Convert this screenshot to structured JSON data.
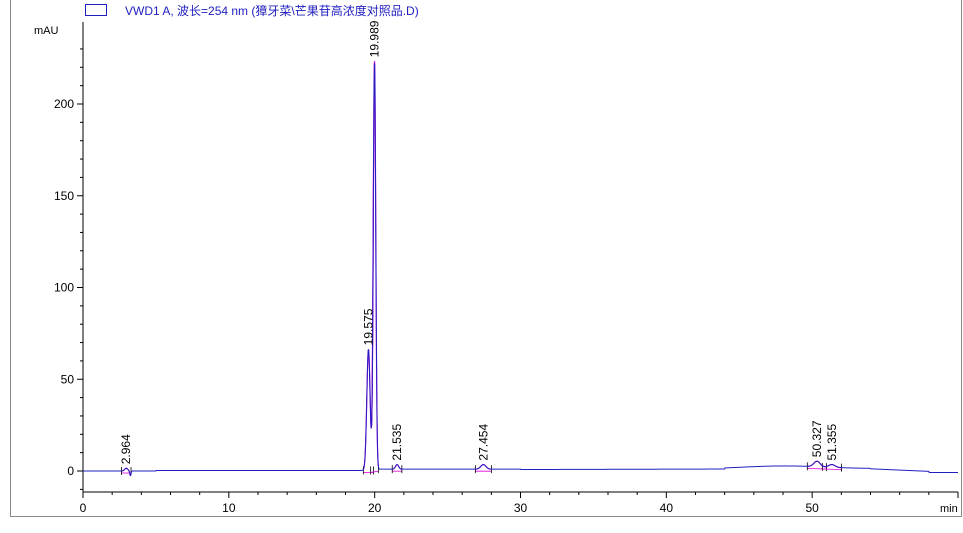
{
  "legend": {
    "label": "VWD1 A, 波长=254 nm (獐牙菜\\芒果苷高浓度对照品.D)",
    "color": "#2020c0"
  },
  "chart_data": {
    "type": "line",
    "xlabel": "min",
    "ylabel": "mAU",
    "xlim": [
      0,
      60
    ],
    "ylim": [
      -12,
      240
    ],
    "x_ticks": [
      0,
      10,
      20,
      30,
      40,
      50
    ],
    "y_ticks": [
      0,
      50,
      100,
      150,
      200
    ],
    "series_color": "#2020c0",
    "integration_color": "#e000e0",
    "peaks": [
      {
        "rt": 2.964,
        "height": 1.5,
        "width": 0.15,
        "label": "2.964"
      },
      {
        "rt": 19.575,
        "height": 66,
        "width": 0.16,
        "label": "19.575"
      },
      {
        "rt": 19.989,
        "height": 223,
        "width": 0.12,
        "label": "19.989"
      },
      {
        "rt": 21.535,
        "height": 2.5,
        "width": 0.15,
        "label": "21.535"
      },
      {
        "rt": 27.454,
        "height": 2.5,
        "width": 0.25,
        "label": "27.454"
      },
      {
        "rt": 50.327,
        "height": 3.0,
        "width": 0.3,
        "label": "50.327"
      },
      {
        "rt": 51.355,
        "height": 1.5,
        "width": 0.3,
        "label": "51.355"
      }
    ],
    "grid": false
  }
}
